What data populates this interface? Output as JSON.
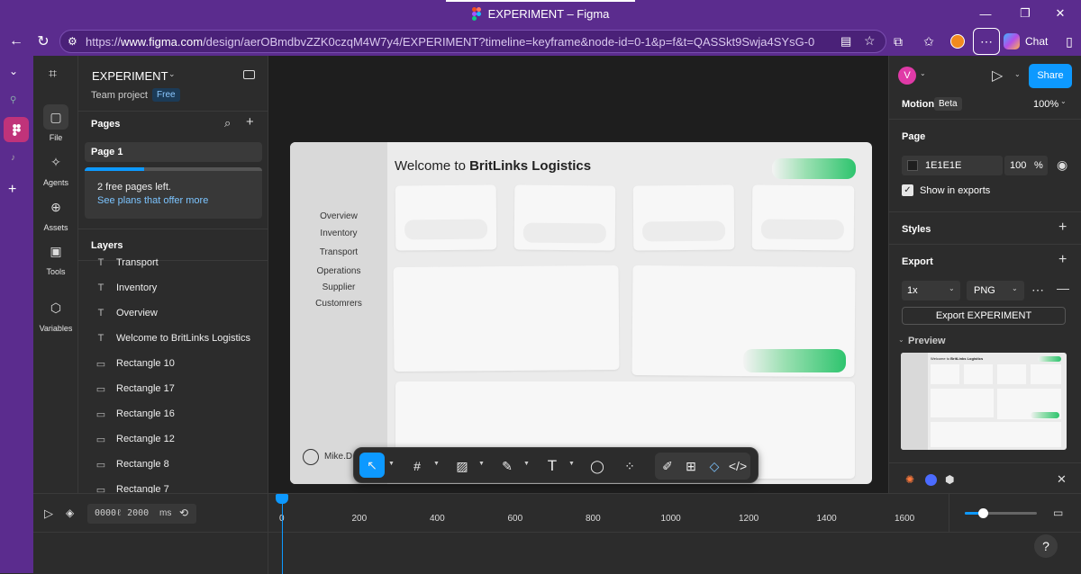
{
  "window": {
    "title": "EXPERIMENT – Figma",
    "minimize_glyph": "—",
    "maximize_glyph": "❐",
    "close_glyph": "✕"
  },
  "browser": {
    "url_prefix": "https://",
    "url_domain": "www.figma.com",
    "url_rest": "/design/aerOBmdbvZZK0czqM4W7y4/EXPERIMENT?timeline=keyframe&node-id=0-1&p=f&t=QASSkt9Swja4SYsG-0",
    "chat_label": "Chat"
  },
  "rail": {
    "items": [
      {
        "label": "File",
        "icon": "file-icon"
      },
      {
        "label": "Agents",
        "icon": "sparkle-icon"
      },
      {
        "label": "Assets",
        "icon": "assets-icon"
      },
      {
        "label": "Tools",
        "icon": "toolbox-icon"
      },
      {
        "label": "Variables",
        "icon": "variables-icon"
      }
    ]
  },
  "file": {
    "name": "EXPERIMENT",
    "team": "Team project",
    "plan_badge": "Free"
  },
  "pages": {
    "header": "Pages",
    "items": [
      "Page 1"
    ],
    "notice": "2 free pages left.",
    "notice_link": "See plans that offer more"
  },
  "layers": {
    "header": "Layers",
    "items": [
      {
        "name": "Transport",
        "type": "text"
      },
      {
        "name": "Inventory",
        "type": "text"
      },
      {
        "name": "Overview",
        "type": "text"
      },
      {
        "name": "Welcome to BritLinks Logistics",
        "type": "text"
      },
      {
        "name": "Rectangle 10",
        "type": "rect"
      },
      {
        "name": "Rectangle 17",
        "type": "rect"
      },
      {
        "name": "Rectangle 16",
        "type": "rect"
      },
      {
        "name": "Rectangle 12",
        "type": "rect"
      },
      {
        "name": "Rectangle 8",
        "type": "rect"
      },
      {
        "name": "Rectangle 7",
        "type": "rect"
      }
    ]
  },
  "design": {
    "heading_plain": "Welcome to ",
    "heading_bold": "BritLinks Logistics",
    "nav": [
      "Overview",
      "Inventory",
      "Transport",
      "Operations",
      "Supplier",
      "Customrers"
    ],
    "user": "Mike.D"
  },
  "right": {
    "avatar_letter": "V",
    "share_label": "Share",
    "motion_label": "Motion",
    "motion_badge": "Beta",
    "zoom": "100%",
    "page_header": "Page",
    "page_color": "1E1E1E",
    "page_opacity": "100",
    "percent": "%",
    "show_exports": "Show in exports",
    "styles_header": "Styles",
    "export_header": "Export",
    "export_scale": "1x",
    "export_format": "PNG",
    "export_button": "Export EXPERIMENT",
    "preview_header": "Preview",
    "preview_title_plain": "Welcome to ",
    "preview_title_bold": "BritLinks Logistics"
  },
  "timeline": {
    "time_display": "0000ℓ 2000",
    "unit": "ms",
    "ticks": [
      "0",
      "200",
      "400",
      "600",
      "800",
      "1000",
      "1200",
      "1400",
      "1600"
    ],
    "help": "?"
  },
  "colors": {
    "browser_chrome": "#5b2c8e",
    "figma_panel": "#2c2c2c",
    "canvas": "#1e1e1e",
    "accent_blue": "#0d99ff",
    "green": "#2ec46e"
  }
}
